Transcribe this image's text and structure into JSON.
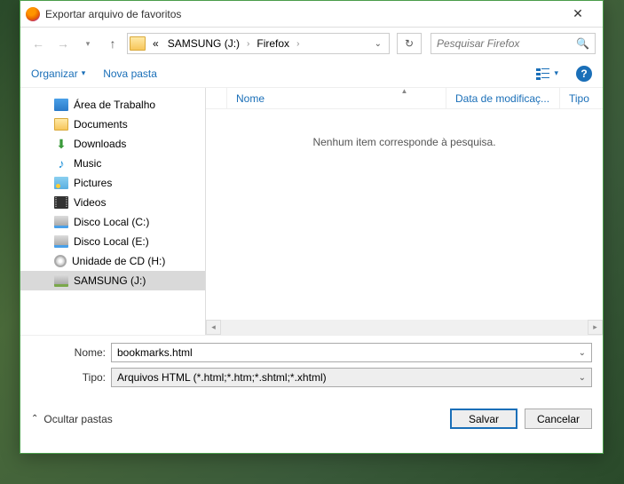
{
  "title": "Exportar arquivo de favoritos",
  "breadcrumb": {
    "prefix": "«",
    "drive": "SAMSUNG (J:)",
    "folder": "Firefox"
  },
  "search": {
    "placeholder": "Pesquisar Firefox"
  },
  "toolbar": {
    "organize": "Organizar",
    "newfolder": "Nova pasta"
  },
  "tree": {
    "items": [
      {
        "label": "Área de Trabalho",
        "icon": "desktop"
      },
      {
        "label": "Documents",
        "icon": "folder"
      },
      {
        "label": "Downloads",
        "icon": "download"
      },
      {
        "label": "Music",
        "icon": "music"
      },
      {
        "label": "Pictures",
        "icon": "pictures"
      },
      {
        "label": "Videos",
        "icon": "videos"
      },
      {
        "label": "Disco Local (C:)",
        "icon": "disk"
      },
      {
        "label": "Disco Local (E:)",
        "icon": "disk"
      },
      {
        "label": "Unidade de CD (H:)",
        "icon": "cd"
      },
      {
        "label": "SAMSUNG (J:)",
        "icon": "usb",
        "selected": true
      }
    ]
  },
  "columns": {
    "name": "Nome",
    "date": "Data de modificaç...",
    "type": "Tipo"
  },
  "empty_message": "Nenhum item corresponde à pesquisa.",
  "form": {
    "name_label": "Nome:",
    "name_value": "bookmarks.html",
    "type_label": "Tipo:",
    "type_value": "Arquivos HTML (*.html;*.htm;*.shtml;*.xhtml)"
  },
  "buttons": {
    "toggle": "Ocultar pastas",
    "save": "Salvar",
    "cancel": "Cancelar"
  }
}
